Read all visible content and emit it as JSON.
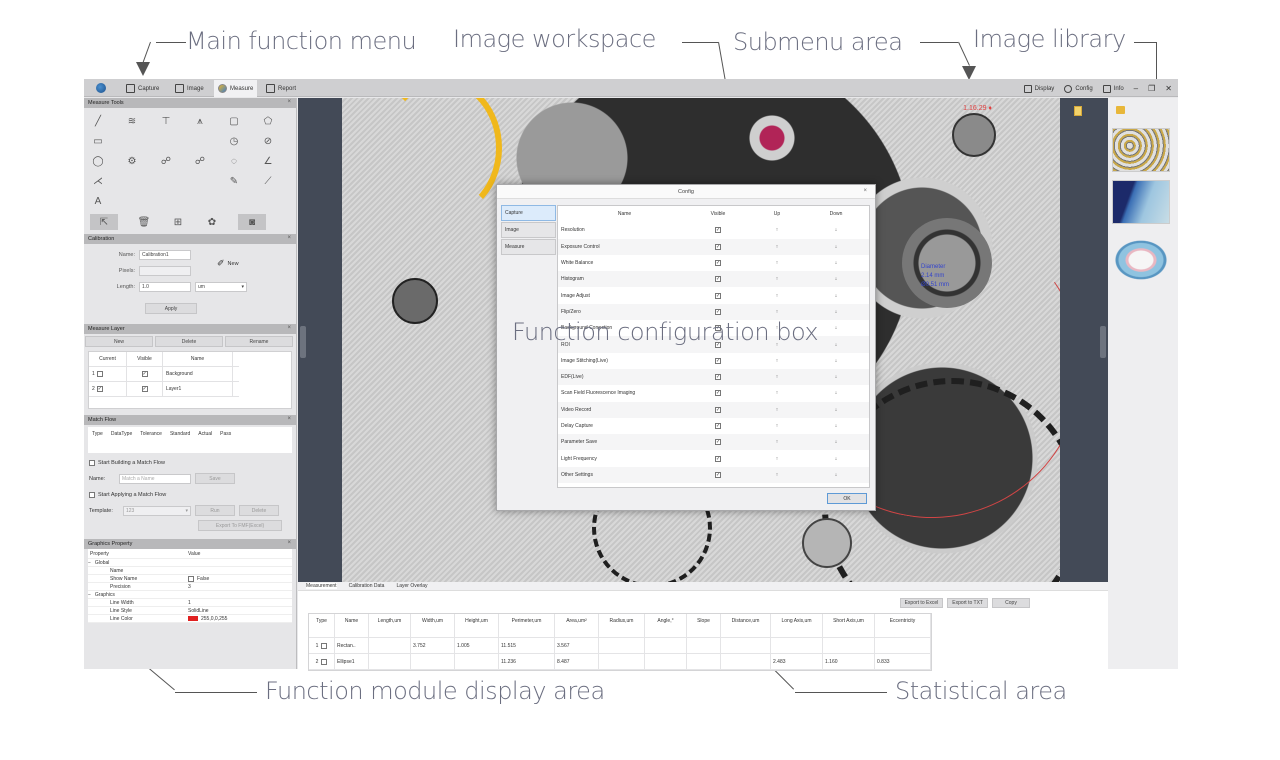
{
  "callouts": {
    "main_function_menu": "Main function menu",
    "image_workspace": "Image workspace",
    "submenu_area": "Submenu area",
    "image_library": "Image library",
    "function_configuration_box": "Function configuration box",
    "function_module_display_area": "Function module display area",
    "statistical_area": "Statistical area"
  },
  "topbar": {
    "logo_icon": "app-logo",
    "main_menu": [
      {
        "label": "Capture",
        "icon": "capture-icon",
        "active": false
      },
      {
        "label": "Image",
        "icon": "image-icon",
        "active": false
      },
      {
        "label": "Measure",
        "icon": "measure-icon",
        "active": true
      },
      {
        "label": "Report",
        "icon": "report-icon",
        "active": false
      }
    ],
    "submenu": [
      {
        "label": "Display",
        "icon": "monitor-icon"
      },
      {
        "label": "Config",
        "icon": "config-icon"
      },
      {
        "label": "Info",
        "icon": "info-icon"
      }
    ],
    "window_controls": {
      "minimize": "–",
      "maximize": "❐",
      "close": "✕"
    }
  },
  "left_panel": {
    "measure_tools": {
      "title": "Measure Tools",
      "collapse": "×",
      "tools": [
        {
          "name": "line-tool",
          "glyph": "╱"
        },
        {
          "name": "parallel-line-tool",
          "glyph": "≋"
        },
        {
          "name": "vertical-line-tool",
          "glyph": "⊤"
        },
        {
          "name": "multi-point-tool",
          "glyph": "⩚"
        },
        {
          "name": "rectangle-tool",
          "glyph": "▢"
        },
        {
          "name": "polygon-tool",
          "glyph": "⬠"
        },
        {
          "name": "rounded-rect-tool",
          "glyph": "▭"
        },
        {
          "name": "",
          "glyph": ""
        },
        {
          "name": "",
          "glyph": ""
        },
        {
          "name": "",
          "glyph": ""
        },
        {
          "name": "circle-center-tool",
          "glyph": "◷"
        },
        {
          "name": "circle-3pt-tool",
          "glyph": "⊘"
        },
        {
          "name": "circle-tool",
          "glyph": "◯"
        },
        {
          "name": "concentric-tool",
          "glyph": "⚙"
        },
        {
          "name": "two-circle-tool",
          "glyph": "☍"
        },
        {
          "name": "circle-distance-tool",
          "glyph": "☍"
        },
        {
          "name": "arc-tool",
          "glyph": "◌"
        },
        {
          "name": "angle-tool",
          "glyph": "∠"
        },
        {
          "name": "four-point-angle-tool",
          "glyph": "⋌"
        },
        {
          "name": "",
          "glyph": ""
        },
        {
          "name": "",
          "glyph": ""
        },
        {
          "name": "",
          "glyph": ""
        },
        {
          "name": "point-tool",
          "glyph": "✎"
        },
        {
          "name": "curve-tool",
          "glyph": "⟋"
        },
        {
          "name": "text-tool",
          "glyph": "A"
        }
      ],
      "actions": [
        {
          "name": "select-tool",
          "glyph": "⇱",
          "selected": true
        },
        {
          "name": "delete-tool",
          "glyph": "🗑",
          "selected": false
        },
        {
          "name": "delete-all-tool",
          "glyph": "⊞",
          "selected": false
        },
        {
          "name": "settings-tool",
          "glyph": "✿",
          "selected": false
        },
        {
          "name": "camera-tool",
          "glyph": "◙",
          "selected": true
        }
      ]
    },
    "calibration": {
      "title": "Calibration",
      "collapse": "×",
      "name_label": "Name:",
      "name_value": "Calibration1",
      "pixels_label": "Pixels:",
      "pixels_value": "",
      "length_label": "Length:",
      "length_value": "1.0",
      "unit_value": "um",
      "new_label": "New",
      "apply_label": "Apply"
    },
    "measure_layer": {
      "title": "Measure Layer",
      "collapse": "×",
      "buttons": [
        "New",
        "Delete",
        "Rename"
      ],
      "columns": [
        "Current",
        "Visible",
        "Name"
      ],
      "rows": [
        {
          "index": "1",
          "current": false,
          "visible": true,
          "name": "Background"
        },
        {
          "index": "2",
          "current": true,
          "visible": true,
          "name": "Layer1"
        }
      ]
    },
    "match_flow": {
      "title": "Match Flow",
      "collapse": "×",
      "columns": [
        "Type",
        "DataType",
        "Tolerance",
        "Standard",
        "Actual",
        "Pass"
      ],
      "start_building_label": "Start Building a Match Flow",
      "name_label": "Name:",
      "name_placeholder": "Match a Name",
      "save_label": "Save",
      "start_applying_label": "Start Applying a Match Flow",
      "template_label": "Template:",
      "template_value": "123",
      "run_label": "Run",
      "delete_label": "Delete",
      "export_label": "Export To FMF(Excel)"
    },
    "graphics_property": {
      "title": "Graphics Property",
      "collapse": "×",
      "header": [
        "Property",
        "Value"
      ],
      "rows": [
        {
          "key": "Global",
          "value": "",
          "group": true
        },
        {
          "key": "Name",
          "value": ""
        },
        {
          "key": "Show Name",
          "value": "False",
          "checkbox": true
        },
        {
          "key": "Precision",
          "value": "3"
        },
        {
          "key": "Graphics",
          "value": "",
          "group": true
        },
        {
          "key": "Line Width",
          "value": "1"
        },
        {
          "key": "Line Style",
          "value": "SolidLine"
        },
        {
          "key": "Line Color",
          "value": "255,0,0,255",
          "swatch": "#e02020"
        }
      ]
    }
  },
  "workspace": {
    "scale_label": "1.16.29 ♦",
    "annotation_lines": [
      "Diameter",
      "2.14 mm",
      "Ø0.51 mm"
    ],
    "export_icon": "export-image-icon"
  },
  "config_dialog": {
    "title": "Config",
    "close": "×",
    "tabs": [
      {
        "label": "Capture",
        "active": true
      },
      {
        "label": "Image",
        "active": false
      },
      {
        "label": "Measure",
        "active": false
      }
    ],
    "columns": [
      "Name",
      "Visible",
      "Up",
      "Down"
    ],
    "rows": [
      {
        "name": "Resolution",
        "visible": true
      },
      {
        "name": "Exposure Control",
        "visible": true
      },
      {
        "name": "White Balance",
        "visible": true
      },
      {
        "name": "Histogram",
        "visible": true
      },
      {
        "name": "Image Adjust",
        "visible": true
      },
      {
        "name": "Flip/Zero",
        "visible": true
      },
      {
        "name": "Background Correction",
        "visible": true
      },
      {
        "name": "ROI",
        "visible": true
      },
      {
        "name": "Image Stitching(Live)",
        "visible": true
      },
      {
        "name": "EDF(Live)",
        "visible": true
      },
      {
        "name": "Scan Field Fluorescence Imaging",
        "visible": true
      },
      {
        "name": "Video Record",
        "visible": true
      },
      {
        "name": "Delay Capture",
        "visible": true
      },
      {
        "name": "Parameter Save",
        "visible": true
      },
      {
        "name": "Light Frequency",
        "visible": true
      },
      {
        "name": "Other Settings",
        "visible": true
      }
    ],
    "up_glyph": "↑",
    "down_glyph": "↓",
    "ok_label": "OK"
  },
  "statistics": {
    "tabs": [
      "Measurement",
      "Calibration Data",
      "Layer Overlay"
    ],
    "buttons": [
      "Export to Excel",
      "Export to TXT",
      "Copy"
    ],
    "columns": [
      "Type",
      "Name",
      "Length,um",
      "Width,um",
      "Height,um",
      "Perimeter,um",
      "Area,um²",
      "Radius,um",
      "Angle,°",
      "Slope",
      "Distance,um",
      "Long Axis,um",
      "Short Axis,um",
      "Eccentricity"
    ],
    "rows": [
      {
        "index": "1",
        "checked": false,
        "cells": [
          "Rectan..",
          "",
          "3.752",
          "1.005",
          "11.515",
          "3.567",
          "",
          "",
          "",
          "",
          "",
          "",
          ""
        ]
      },
      {
        "index": "2",
        "checked": false,
        "cells": [
          "Ellipse1",
          "",
          "",
          "",
          "11.236",
          "8.487",
          "",
          "",
          "",
          "",
          "2.483",
          "1.160",
          "0.833"
        ]
      }
    ]
  }
}
